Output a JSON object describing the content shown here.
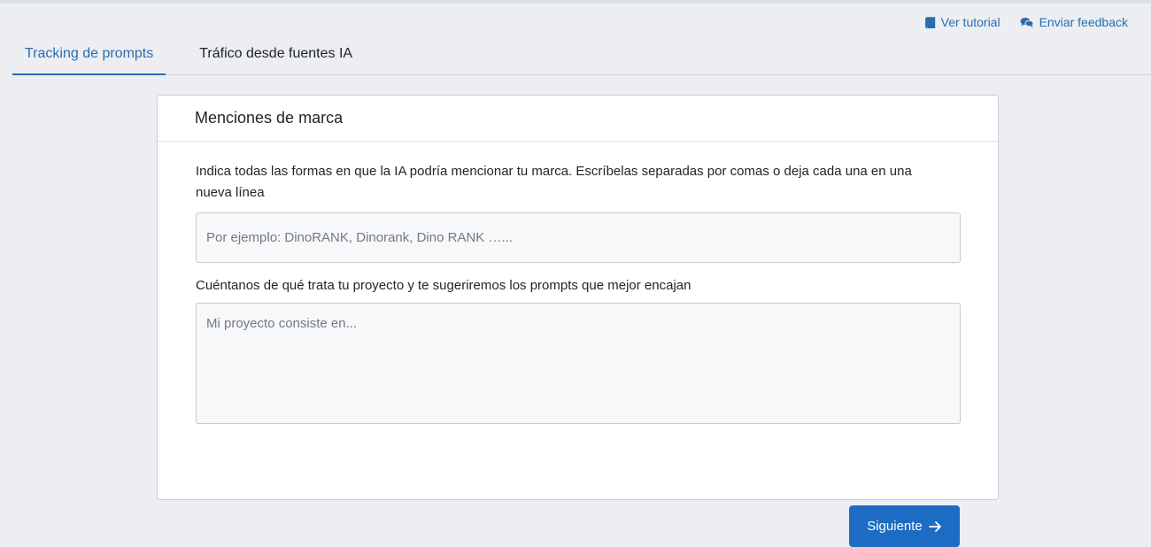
{
  "header": {
    "links": [
      {
        "label": "Ver tutorial",
        "icon": "book-icon"
      },
      {
        "label": "Enviar feedback",
        "icon": "comments-icon"
      }
    ]
  },
  "tabs": [
    {
      "label": "Tracking de prompts",
      "active": true
    },
    {
      "label": "Tráfico desde fuentes IA",
      "active": false
    }
  ],
  "card": {
    "title": "Menciones de marca",
    "description": "Indica todas las formas en que la IA podría mencionar tu marca. Escríbelas separadas por comas o deja cada una en una nueva línea",
    "brand_input": {
      "placeholder": "Por ejemplo: DinoRANK, Dinorank, Dino RANK …...",
      "value": ""
    },
    "project_label": "Cuéntanos de qué trata tu proyecto y te sugeriremos los prompts que mejor encajan",
    "project_input": {
      "placeholder": "Mi proyecto consiste en...",
      "value": ""
    },
    "next_button": {
      "label": "Siguiente",
      "icon": "arrow-right-icon"
    }
  },
  "colors": {
    "accent": "#2b6cb0",
    "button": "#1c6cc4",
    "background": "#eceef2"
  }
}
